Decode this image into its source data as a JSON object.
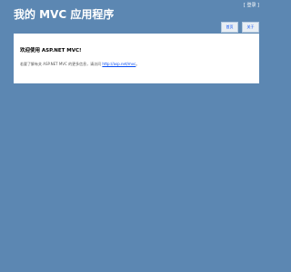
{
  "header": {
    "title": "我的 MVC 应用程序",
    "login_bracket_open": "[ ",
    "login_link": "登录",
    "login_bracket_close": " ]"
  },
  "menu": {
    "items": [
      {
        "label": "首页"
      },
      {
        "label": "关于"
      }
    ]
  },
  "main": {
    "heading": "欢迎使用 ASP.NET MVC!",
    "text_prefix": "若要了解有关 ASP.NET MVC 的更多信息，请访问 ",
    "link": "http://asp.net/mvc",
    "text_suffix": "。"
  },
  "colors": {
    "page_background": "#5c87b2",
    "content_background": "#ffffff",
    "menu_background": "#e8eef4",
    "link": "#034af3"
  }
}
